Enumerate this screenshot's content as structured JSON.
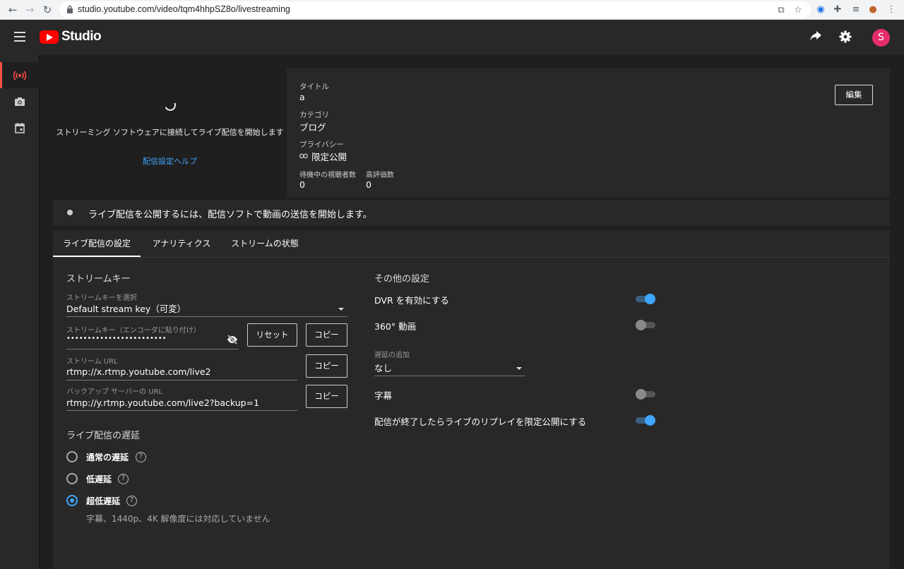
{
  "browser": {
    "url": "studio.youtube.com/video/tqm4hhpSZ8o/livestreaming"
  },
  "header": {
    "logo_text": "Studio",
    "avatar_letter": "S"
  },
  "preview": {
    "message": "ストリーミング ソフトウェアに接続してライブ配信を開始します",
    "help_link": "配信設定ヘルプ"
  },
  "info": {
    "title_label": "タイトル",
    "title_value": "a",
    "category_label": "カテゴリ",
    "category_value": "ブログ",
    "privacy_label": "プライバシー",
    "privacy_value": "限定公開",
    "viewers_label": "待機中の視聴者数",
    "viewers_value": "0",
    "likes_label": "高評価数",
    "likes_value": "0",
    "edit_button": "編集"
  },
  "status": {
    "message": "ライブ配信を公開するには、配信ソフトで動画の送信を開始します。"
  },
  "tabs": [
    {
      "label": "ライブ配信の設定"
    },
    {
      "label": "アナリティクス"
    },
    {
      "label": "ストリームの状態"
    }
  ],
  "stream_key": {
    "section_title": "ストリームキー",
    "select_label": "ストリームキーを選択",
    "select_value": "Default stream key（可変）",
    "key_label": "ストリームキー（エンコーダに貼り付け）",
    "key_value": "••••••••••••••••••••••••",
    "reset_button": "リセット",
    "copy_button": "コピー",
    "url_label": "ストリーム URL",
    "url_value": "rtmp://x.rtmp.youtube.com/live2",
    "backup_label": "バックアップ サーバーの URL",
    "backup_value": "rtmp://y.rtmp.youtube.com/live2?backup=1"
  },
  "latency": {
    "section_title": "ライブ配信の遅延",
    "options": [
      {
        "label": "通常の遅延",
        "checked": false
      },
      {
        "label": "低遅延",
        "checked": false
      },
      {
        "label": "超低遅延",
        "checked": true
      }
    ],
    "note": "字幕、1440p、4K 解像度には対応していません"
  },
  "other": {
    "section_title": "その他の設定",
    "dvr_label": "DVR を有効にする",
    "dvr_on": true,
    "vr_label": "360° 動画",
    "vr_on": false,
    "delay_label": "遅延の追加",
    "delay_value": "なし",
    "captions_label": "字幕",
    "captions_on": false,
    "replay_label": "配信が終了したらライブのリプレイを限定公開にする",
    "replay_on": true
  },
  "colors": {
    "accent": "#3ea6ff",
    "brand": "#ff0000",
    "active_rail": "#ff4e45",
    "avatar": "#e52d6b"
  }
}
